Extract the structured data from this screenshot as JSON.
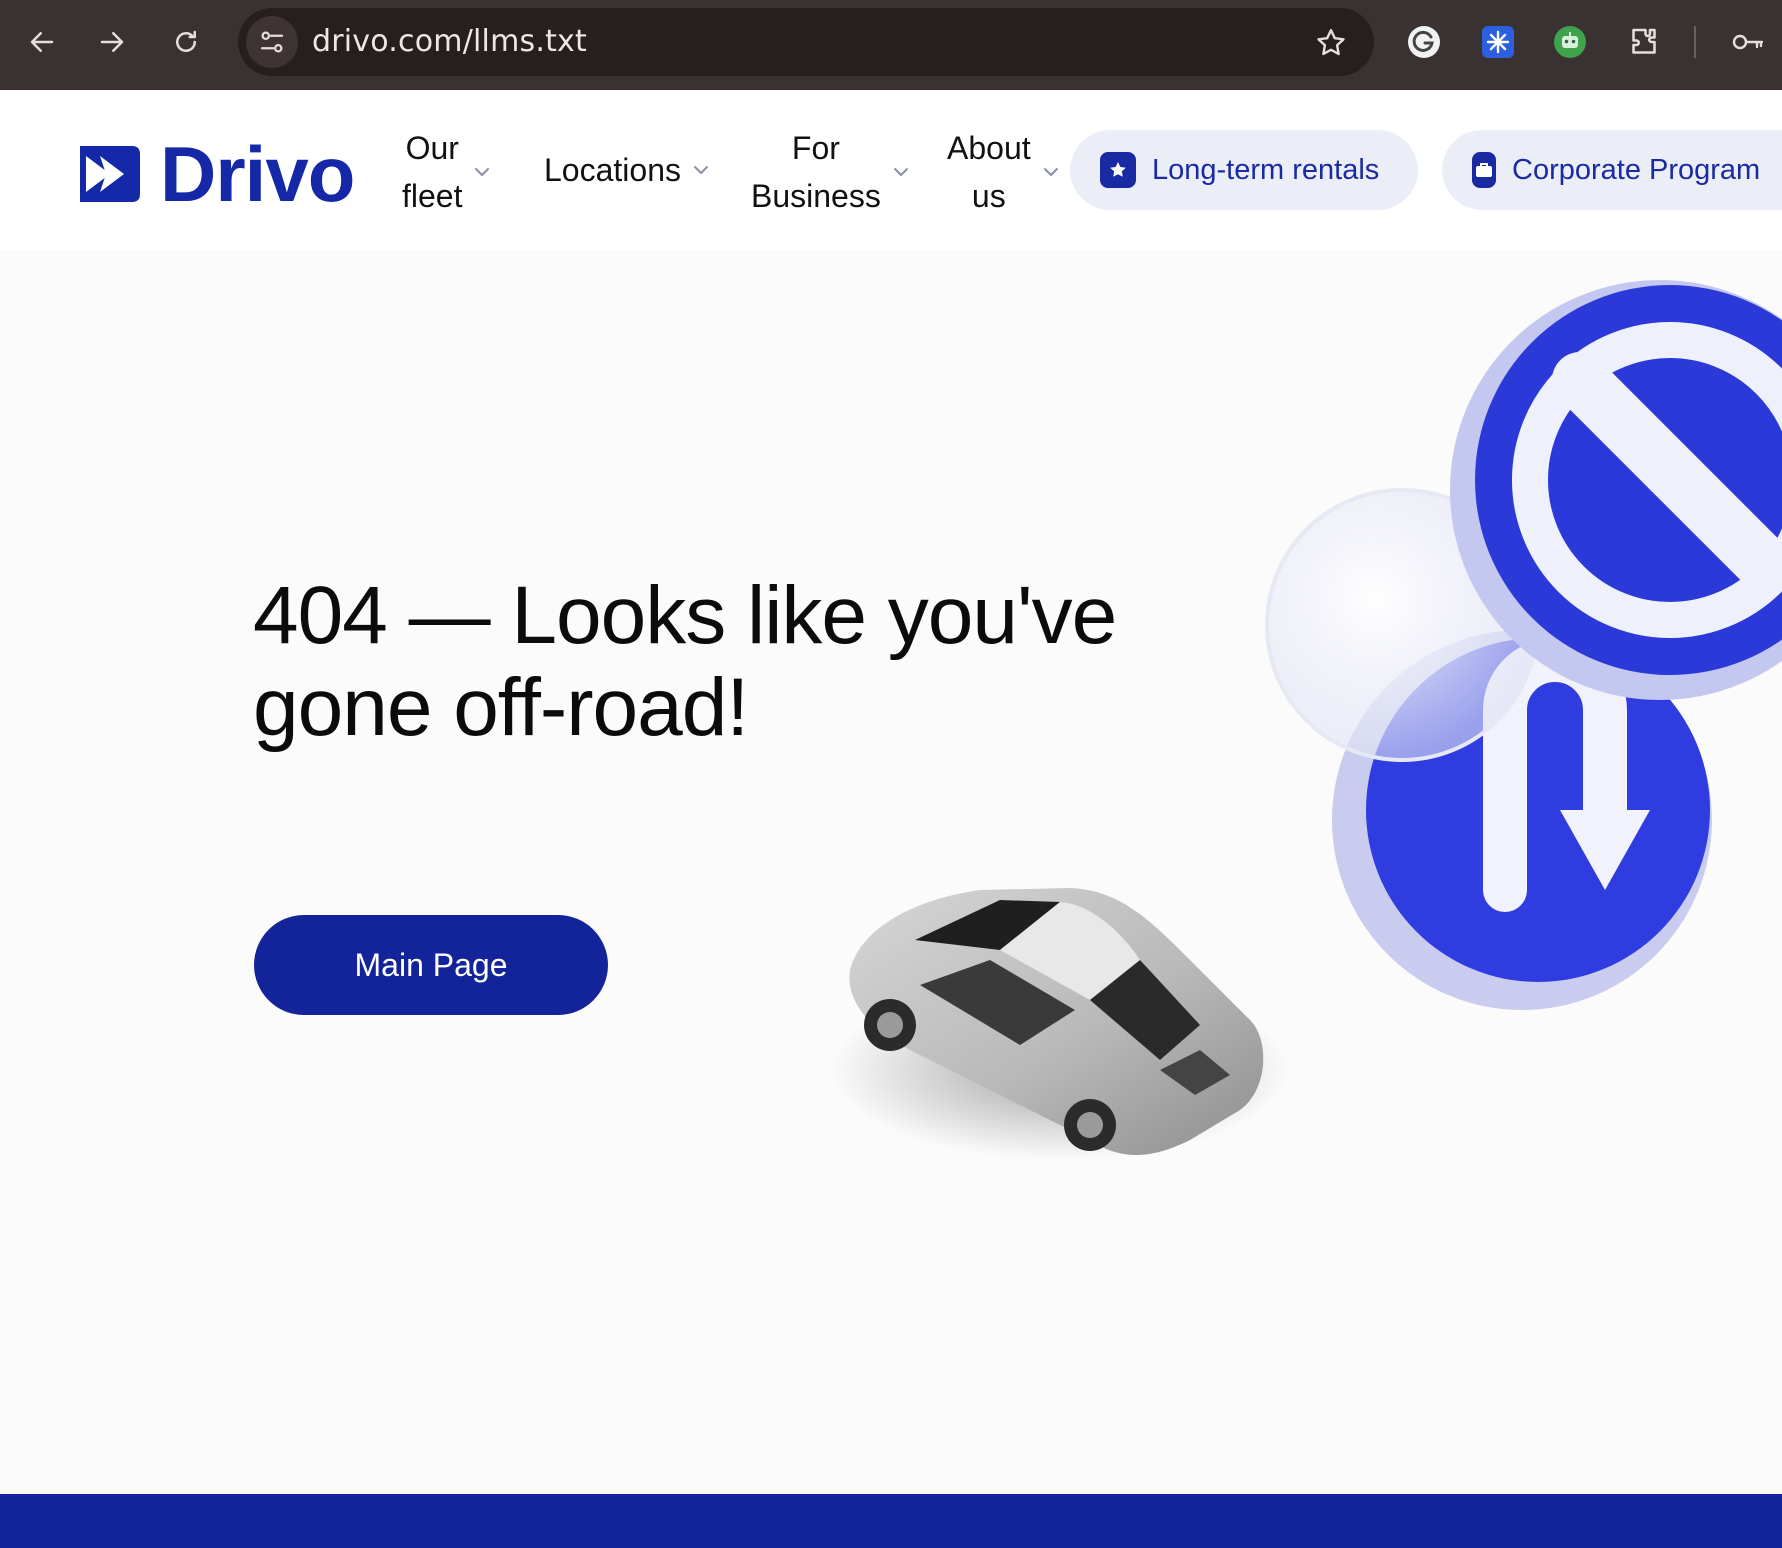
{
  "browser": {
    "url": "drivo.com/llms.txt",
    "icons": {
      "back": "arrow-left-icon",
      "forward": "arrow-right-icon",
      "reload": "reload-icon",
      "site_info": "site-settings-icon",
      "bookmark": "star-icon",
      "extensions": [
        "grammarly-icon",
        "snowflake-extension-icon",
        "robot-extension-icon",
        "puzzle-icon"
      ],
      "passwords": "key-icon"
    }
  },
  "header": {
    "logo_text": "Drivo",
    "nav": [
      {
        "line1": "Our",
        "line2": "fleet"
      },
      {
        "line1": "Locations",
        "line2": ""
      },
      {
        "line1": "For",
        "line2": "Business"
      },
      {
        "line1": "About",
        "line2": "us"
      }
    ],
    "pills": [
      {
        "label": "Long-term rentals",
        "icon": "star-badge-icon"
      },
      {
        "label": "Corporate Program",
        "icon": "briefcase-icon"
      }
    ]
  },
  "main": {
    "headline_line1": "404 — Looks like you've",
    "headline_line2": "gone off-road!",
    "button_label": "Main Page"
  },
  "colors": {
    "brand": "#13249a",
    "chrome": "#3a3232",
    "pill_bg": "#eceef7",
    "sign_blue": "#2f3de0"
  }
}
